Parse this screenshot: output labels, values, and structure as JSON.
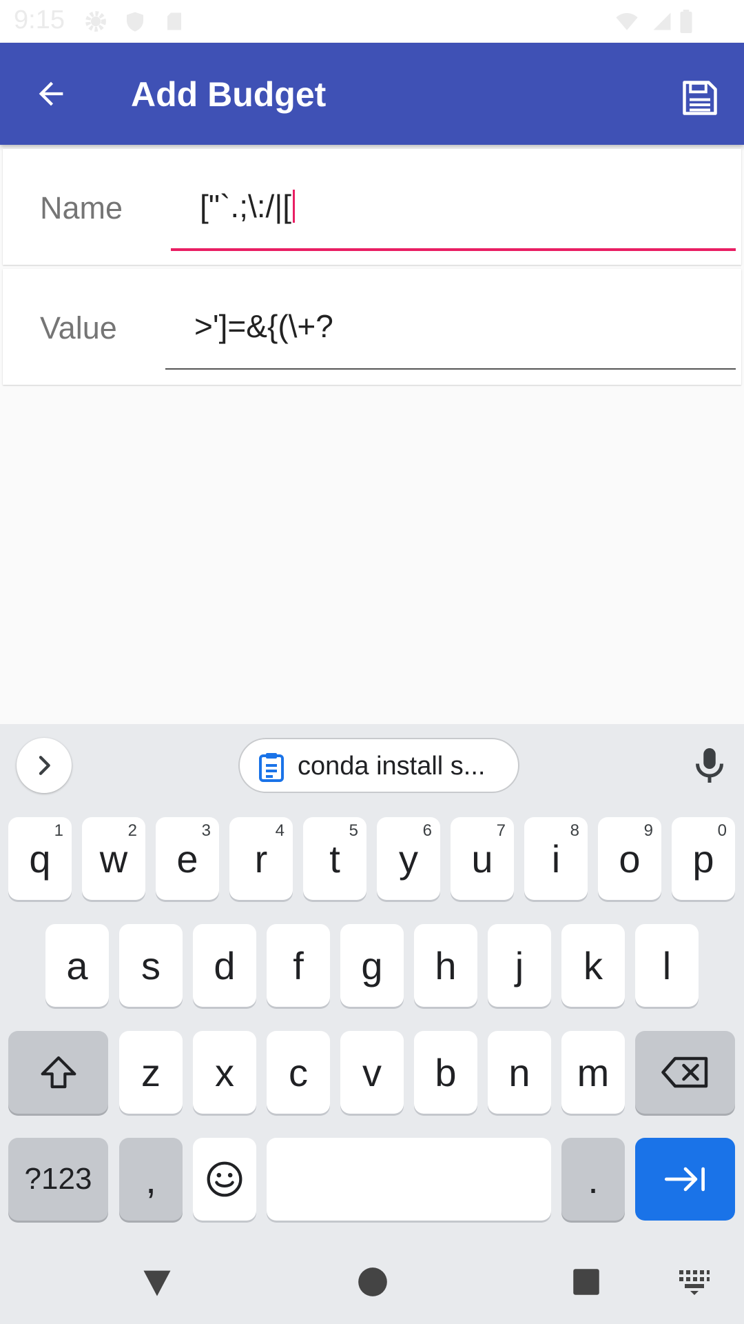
{
  "status_bar": {
    "time": "9:15",
    "icons": [
      "gear-icon",
      "shield-icon",
      "sd-card-icon",
      "wifi-icon",
      "signal-icon",
      "battery-icon"
    ]
  },
  "app_bar": {
    "title": "Add Budget",
    "back_icon": "arrow-left-icon",
    "save_icon": "floppy-disk-icon",
    "color": "#3f51b5"
  },
  "form": {
    "name_label": "Name",
    "name_value": "[\"`.;\\:/|[",
    "value_label": "Value",
    "value_value": ">']=&{(\\+?",
    "focus_color": "#e91e63"
  },
  "keyboard": {
    "clipboard_suggestion": "conda install s...",
    "row1": [
      {
        "key": "q",
        "hint": "1"
      },
      {
        "key": "w",
        "hint": "2"
      },
      {
        "key": "e",
        "hint": "3"
      },
      {
        "key": "r",
        "hint": "4"
      },
      {
        "key": "t",
        "hint": "5"
      },
      {
        "key": "y",
        "hint": "6"
      },
      {
        "key": "u",
        "hint": "7"
      },
      {
        "key": "i",
        "hint": "8"
      },
      {
        "key": "o",
        "hint": "9"
      },
      {
        "key": "p",
        "hint": "0"
      }
    ],
    "row2": [
      "a",
      "s",
      "d",
      "f",
      "g",
      "h",
      "j",
      "k",
      "l"
    ],
    "row3": [
      "z",
      "x",
      "c",
      "v",
      "b",
      "n",
      "m"
    ],
    "symbols_key": "?123",
    "comma_key": ",",
    "period_key": ".",
    "action_color": "#1a73e8"
  },
  "nav_bar": {
    "icons": [
      "back-triangle-icon",
      "home-circle-icon",
      "recents-square-icon",
      "keyboard-switch-icon"
    ]
  }
}
